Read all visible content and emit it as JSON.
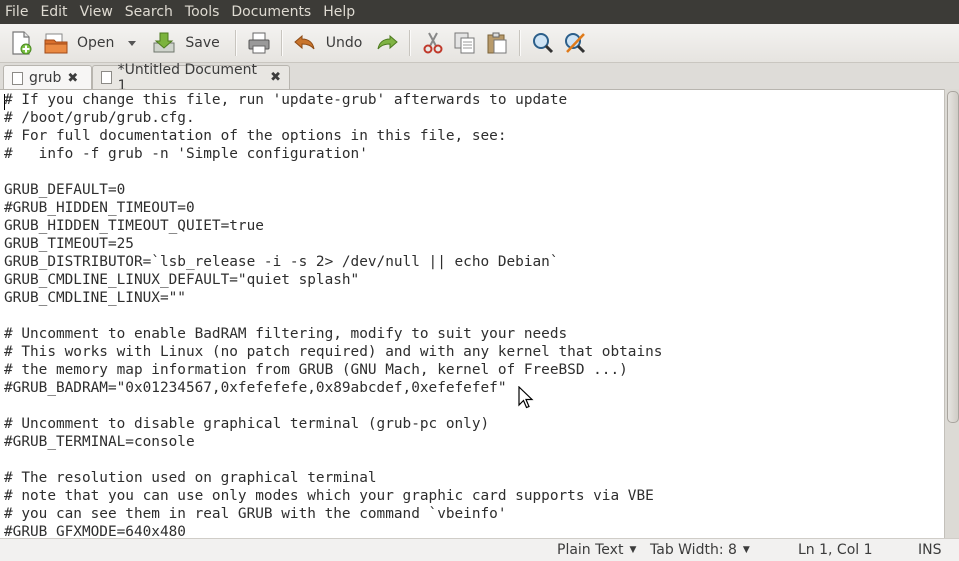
{
  "menu": [
    "File",
    "Edit",
    "View",
    "Search",
    "Tools",
    "Documents",
    "Help"
  ],
  "toolbar": {
    "open_label": "Open",
    "save_label": "Save",
    "undo_label": "Undo"
  },
  "tabs": [
    {
      "label": "grub",
      "active": true
    },
    {
      "label": "*Untitled Document 1",
      "active": false
    }
  ],
  "editor": {
    "lines": [
      "# If you change this file, run 'update-grub' afterwards to update",
      "# /boot/grub/grub.cfg.",
      "# For full documentation of the options in this file, see:",
      "#   info -f grub -n 'Simple configuration'",
      "",
      "GRUB_DEFAULT=0",
      "#GRUB_HIDDEN_TIMEOUT=0",
      "GRUB_HIDDEN_TIMEOUT_QUIET=true",
      "GRUB_TIMEOUT=25",
      "GRUB_DISTRIBUTOR=`lsb_release -i -s 2> /dev/null || echo Debian`",
      "GRUB_CMDLINE_LINUX_DEFAULT=\"quiet splash\"",
      "GRUB_CMDLINE_LINUX=\"\"",
      "",
      "# Uncomment to enable BadRAM filtering, modify to suit your needs",
      "# This works with Linux (no patch required) and with any kernel that obtains",
      "# the memory map information from GRUB (GNU Mach, kernel of FreeBSD ...)",
      "#GRUB_BADRAM=\"0x01234567,0xfefefefe,0x89abcdef,0xefefefef\"",
      "",
      "# Uncomment to disable graphical terminal (grub-pc only)",
      "#GRUB_TERMINAL=console",
      "",
      "# The resolution used on graphical terminal",
      "# note that you can use only modes which your graphic card supports via VBE",
      "# you can see them in real GRUB with the command `vbeinfo'",
      "#GRUB_GFXMODE=640x480"
    ]
  },
  "status": {
    "language": "Plain Text",
    "tab_width": "Tab Width: 8",
    "position": "Ln 1, Col 1",
    "mode": "INS"
  },
  "colors": {
    "menubar_bg": "#3c3b37",
    "menubar_text": "#dfdbd2",
    "window_bg": "#f2f1f0",
    "editor_bg": "#ffffff"
  }
}
